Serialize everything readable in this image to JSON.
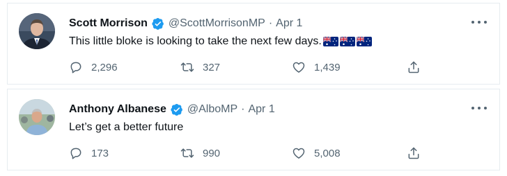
{
  "tweets": [
    {
      "name": "Scott Morrison",
      "handle": "@ScottMorrisonMP",
      "separator": "·",
      "date": "Apr 1",
      "text": "This little bloke is looking to take the next few days.",
      "emoji": [
        "australia-flag",
        "australia-flag",
        "australia-flag"
      ],
      "replies": "2,296",
      "retweets": "327",
      "likes": "1,439"
    },
    {
      "name": "Anthony Albanese",
      "handle": "@AlboMP",
      "separator": "·",
      "date": "Apr 1",
      "text": "Let’s get a better future",
      "emoji": [],
      "replies": "173",
      "retweets": "990",
      "likes": "5,008"
    }
  ],
  "colors": {
    "verified": "#1d9bf0",
    "muted_text": "#536471",
    "primary_text": "#0f1419",
    "border": "#e6ecf0"
  },
  "icons": {
    "reply": "reply-icon",
    "retweet": "retweet-icon",
    "like": "like-icon",
    "share": "share-icon",
    "more": "more-icon",
    "verified": "verified-badge-icon"
  }
}
